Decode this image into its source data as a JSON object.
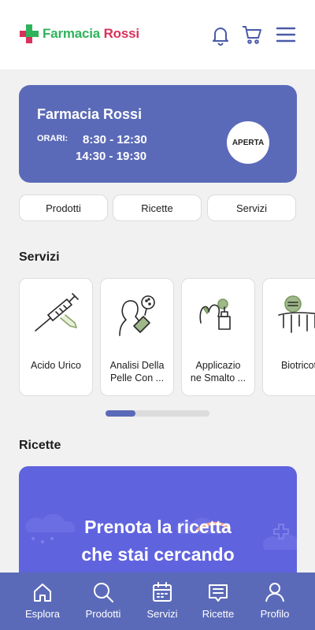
{
  "header": {
    "brand_part1": "Farmacia",
    "brand_part2": "Rossi",
    "icons": [
      "bell-icon",
      "cart-icon",
      "menu-icon"
    ]
  },
  "store": {
    "name": "Farmacia Rossi",
    "hours_label": "ORARI:",
    "hours": [
      "8:30 - 12:30",
      "14:30 - 19:30"
    ],
    "status": "APERTA"
  },
  "tabs": [
    {
      "label": "Prodotti"
    },
    {
      "label": "Ricette"
    },
    {
      "label": "Servizi"
    }
  ],
  "services": {
    "title": "Servizi",
    "items": [
      {
        "label": "Acido Urico",
        "icon": "syringe-icon"
      },
      {
        "label": "Analisi Della\nPelle Con ...",
        "icon": "skin-analysis-icon"
      },
      {
        "label": "Applicazio\nne Smalto ...",
        "icon": "nail-polish-icon"
      },
      {
        "label": "Biotricote",
        "icon": "hair-icon"
      }
    ],
    "scroll_progress": 0.29
  },
  "recipes": {
    "title": "Ricette",
    "promo_line1": "Prenota la ricetta",
    "promo_line2": "che stai cercando"
  },
  "nav": {
    "items": [
      {
        "label": "Esplora",
        "icon": "home-icon"
      },
      {
        "label": "Prodotti",
        "icon": "search-icon"
      },
      {
        "label": "Servizi",
        "icon": "calendar-icon"
      },
      {
        "label": "Ricette",
        "icon": "prescription-icon"
      },
      {
        "label": "Profilo",
        "icon": "user-icon"
      }
    ]
  },
  "colors": {
    "accent": "#5b6ab8",
    "promo": "#6063de",
    "brand_green": "#2fb35b",
    "brand_red": "#d8325a"
  }
}
